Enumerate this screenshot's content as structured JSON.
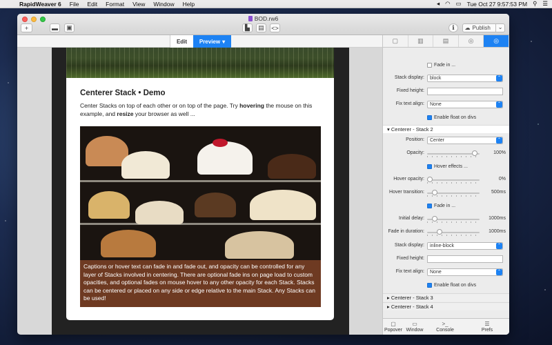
{
  "menubar": {
    "app": "RapidWeaver 6",
    "items": [
      "File",
      "Edit",
      "Format",
      "View",
      "Window",
      "Help"
    ],
    "clock": "Tue Oct 27  9:57:53 PM"
  },
  "window": {
    "title": "BOD.rw6",
    "publish_label": "Publish"
  },
  "tabs": {
    "edit": "Edit",
    "preview": "Preview"
  },
  "page": {
    "heading": "Centerer Stack • Demo",
    "intro_1": "Center Stacks on top of each other or on top of the page. Try ",
    "intro_bold_1": "hovering",
    "intro_2": " the mouse on this example, and ",
    "intro_bold_2": "resize",
    "intro_3": " your browser as well ...",
    "caption": "Captions or hover text can fade in and fade out, and opacity can be controlled for any layer of Stacks involved in centering. There are optional fade ins on page load to custom opacities, and optional fades on mouse hover to any other opacity for each Stack. Stacks can be centered or placed on any side or edge relative to the main Stack. Any Stacks can be used!"
  },
  "inspector": {
    "top": {
      "fade_in": "Fade in ...",
      "stack_display_label": "Stack display:",
      "stack_display_value": "block",
      "fixed_height_label": "Fixed height:",
      "fix_text_align_label": "Fix text align:",
      "fix_text_align_value": "None",
      "enable_float": "Enable float on divs"
    },
    "stack2": {
      "title": "Centerer - Stack 2",
      "position_label": "Position:",
      "position_value": "Center",
      "opacity_label": "Opacity:",
      "opacity_value": "100%",
      "opacity_level": 0.95,
      "hover_effects": "Hover effects ...",
      "hover_opacity_label": "Hover opacity:",
      "hover_opacity_value": "0%",
      "hover_opacity_level": 0.0,
      "hover_transition_label": "Hover transition:",
      "hover_transition_value": "500ms",
      "hover_transition_level": 0.1,
      "fade_in": "Fade in ...",
      "initial_delay_label": "Initial delay:",
      "initial_delay_value": "1000ms",
      "initial_delay_level": 0.1,
      "fade_in_duration_label": "Fade in duration:",
      "fade_in_duration_value": "1000ms",
      "fade_in_duration_level": 0.2,
      "stack_display_label": "Stack display:",
      "stack_display_value": "inline-block",
      "fixed_height_label": "Fixed height:",
      "fix_text_align_label": "Fix text align:",
      "fix_text_align_value": "None",
      "enable_float": "Enable float on divs"
    },
    "stack3": "Centerer - Stack 3",
    "stack4": "Centerer - Stack 4",
    "footer": [
      "Popover",
      "Window",
      "Console",
      "Prefs"
    ]
  }
}
